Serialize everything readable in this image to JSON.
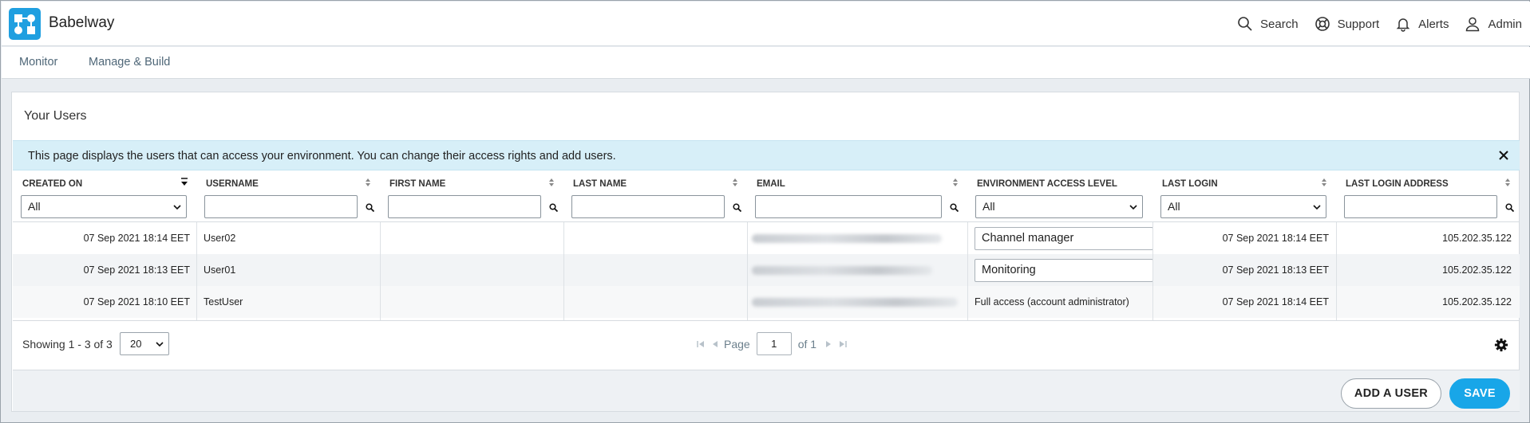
{
  "app": {
    "title": "Babelway"
  },
  "top_actions": [
    {
      "label": "Search",
      "icon": "search-icon"
    },
    {
      "label": "Support",
      "icon": "lifebuoy-icon"
    },
    {
      "label": "Alerts",
      "icon": "bell-icon"
    },
    {
      "label": "Admin",
      "icon": "user-icon"
    }
  ],
  "nav": {
    "items": [
      "Monitor",
      "Manage & Build"
    ]
  },
  "page": {
    "title": "Your Users",
    "info": "This page displays the users that can access your environment. You can change their access rights and add users."
  },
  "table": {
    "columns": [
      {
        "label": "CREATED ON",
        "filter": "select",
        "filter_value": "All",
        "sorted": "desc"
      },
      {
        "label": "USERNAME",
        "filter": "text",
        "filter_value": ""
      },
      {
        "label": "FIRST NAME",
        "filter": "text",
        "filter_value": ""
      },
      {
        "label": "LAST NAME",
        "filter": "text",
        "filter_value": ""
      },
      {
        "label": "EMAIL",
        "filter": "text",
        "filter_value": ""
      },
      {
        "label": "ENVIRONMENT ACCESS LEVEL",
        "filter": "select",
        "filter_value": "All"
      },
      {
        "label": "LAST LOGIN",
        "filter": "select",
        "filter_value": "All"
      },
      {
        "label": "LAST LOGIN ADDRESS",
        "filter": "text",
        "filter_value": ""
      }
    ],
    "rows": [
      {
        "created_on": "07 Sep 2021 18:14 EET",
        "username": "User02",
        "first_name": "",
        "last_name": "",
        "email": "(redacted)",
        "access_level": "Channel manager",
        "access_editable": true,
        "last_login": "07 Sep 2021 18:14 EET",
        "last_login_address": "105.202.35.122"
      },
      {
        "created_on": "07 Sep 2021 18:13 EET",
        "username": "User01",
        "first_name": "",
        "last_name": "",
        "email": "(redacted)",
        "access_level": "Monitoring",
        "access_editable": true,
        "last_login": "07 Sep 2021 18:13 EET",
        "last_login_address": "105.202.35.122"
      },
      {
        "created_on": "07 Sep 2021 18:10 EET",
        "username": "TestUser",
        "first_name": "",
        "last_name": "",
        "email": "(redacted)",
        "access_level": "Full access (account administrator)",
        "access_editable": false,
        "last_login": "07 Sep 2021 18:14 EET",
        "last_login_address": "105.202.35.122"
      }
    ]
  },
  "pagination": {
    "showing": "Showing 1 - 3 of 3",
    "page_size": "20",
    "page_label": "Page",
    "current_page": "1",
    "of_label": "of 1"
  },
  "buttons": {
    "add_user": "ADD A USER",
    "save": "SAVE"
  },
  "colors": {
    "brand": "#1f9fe0",
    "primary_button": "#18a6e8",
    "info_banner": "#d7eff8",
    "nav_text": "#4f6778"
  }
}
